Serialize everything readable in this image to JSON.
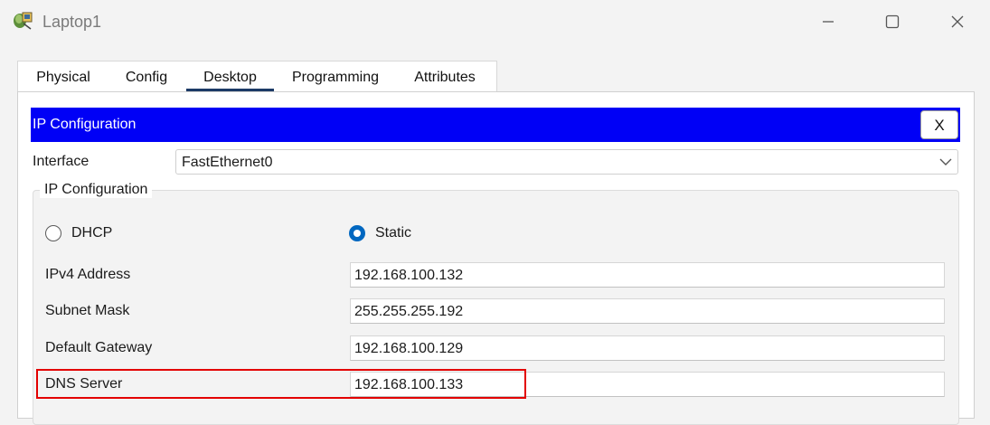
{
  "window": {
    "title": "Laptop1",
    "icon": "laptop-app-icon",
    "controls": [
      "minimize-icon",
      "maximize-icon",
      "close-icon"
    ]
  },
  "tabs": [
    {
      "label": "Physical"
    },
    {
      "label": "Config"
    },
    {
      "label": "Desktop",
      "active": true
    },
    {
      "label": "Programming"
    },
    {
      "label": "Attributes"
    }
  ],
  "ip_config": {
    "header_title": "IP Configuration",
    "close_label": "X",
    "interface_label": "Interface",
    "interface_value": "FastEthernet0",
    "group_title": "IP Configuration",
    "dhcp_label": "DHCP",
    "static_label": "Static",
    "mode_selected": "Static",
    "fields": {
      "ipv4": {
        "label": "IPv4 Address",
        "value": "192.168.100.132"
      },
      "subnet": {
        "label": "Subnet Mask",
        "value": "255.255.255.192"
      },
      "gateway": {
        "label": "Default Gateway",
        "value": "192.168.100.129"
      },
      "dns": {
        "label": "DNS Server",
        "value": "192.168.100.133"
      }
    }
  },
  "colors": {
    "header_blue": "#0000f6",
    "radio_selected": "#0067c0",
    "highlight_red": "#e30000",
    "active_tab_underline": "#1c3a66"
  }
}
